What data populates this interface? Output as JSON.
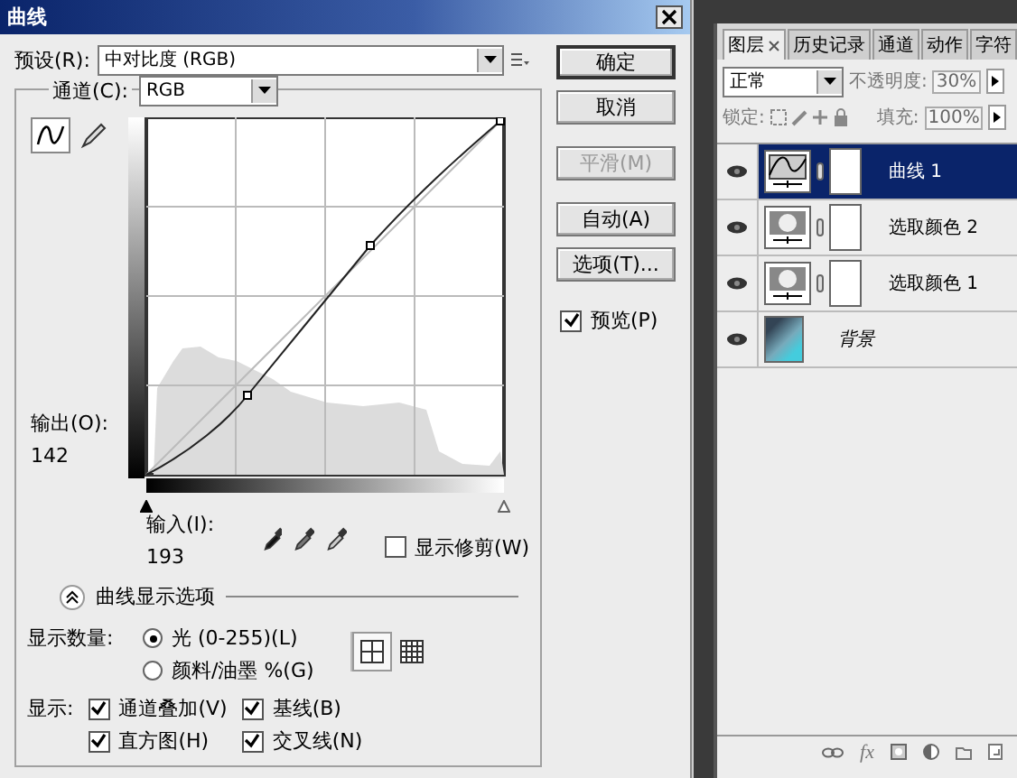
{
  "dialog": {
    "title": "曲线",
    "preset": {
      "label": "预设(R):",
      "value": "中对比度 (RGB)"
    },
    "channel": {
      "label": "通道(C):",
      "value": "RGB"
    },
    "tools": [
      {
        "kind": "curve",
        "selected": true
      },
      {
        "kind": "pencil",
        "selected": false
      }
    ],
    "output": {
      "label": "输出(O):",
      "value": "142"
    },
    "input": {
      "label": "输入(I):",
      "value": "193"
    },
    "show_clipping": {
      "label": "显示修剪(W)",
      "checked": false
    },
    "display_options": {
      "label": "曲线显示选项",
      "expanded": true
    },
    "amount": {
      "label": "显示数量:",
      "options": [
        {
          "label": "光 (0-255)(L)",
          "selected": true
        },
        {
          "label": "颜料/油墨 %(G)",
          "selected": false
        }
      ]
    },
    "grid_sizes": [
      {
        "kind": "simple",
        "selected": true
      },
      {
        "kind": "detailed",
        "selected": false
      }
    ],
    "show": {
      "label": "显示:",
      "options": [
        {
          "label": "通道叠加(V)",
          "checked": true
        },
        {
          "label": "基线(B)",
          "checked": true
        },
        {
          "label": "直方图(H)",
          "checked": true
        },
        {
          "label": "交叉线(N)",
          "checked": true
        }
      ]
    },
    "buttons": [
      {
        "label": "确定",
        "default": true,
        "disabled": false
      },
      {
        "label": "取消",
        "default": false,
        "disabled": false
      },
      {
        "label": "平滑(M)",
        "default": false,
        "disabled": true
      },
      {
        "label": "自动(A)",
        "default": false,
        "disabled": false
      },
      {
        "label": "选项(T)...",
        "default": false,
        "disabled": false
      }
    ],
    "preview": {
      "label": "预览(P)",
      "checked": true
    }
  },
  "layers_panel": {
    "tabs": [
      {
        "label": "图层",
        "selected": true
      },
      {
        "label": "历史记录",
        "selected": false
      },
      {
        "label": "通道",
        "selected": false
      },
      {
        "label": "动作",
        "selected": false
      },
      {
        "label": "字符",
        "selected": false
      }
    ],
    "blend_mode": "正常",
    "opacity": {
      "label": "不透明度:",
      "value": "30%"
    },
    "lock_label": "锁定:",
    "fill": {
      "label": "填充:",
      "value": "100%"
    },
    "layers": [
      {
        "name": "曲线 1",
        "kind": "curves",
        "selected": true,
        "visible": true
      },
      {
        "name": "选取颜色 2",
        "kind": "selective-color",
        "selected": false,
        "visible": true
      },
      {
        "name": "选取颜色 1",
        "kind": "selective-color",
        "selected": false,
        "visible": true
      },
      {
        "name": "背景",
        "kind": "photo",
        "selected": false,
        "visible": true
      }
    ],
    "fx_label": "fx"
  }
}
